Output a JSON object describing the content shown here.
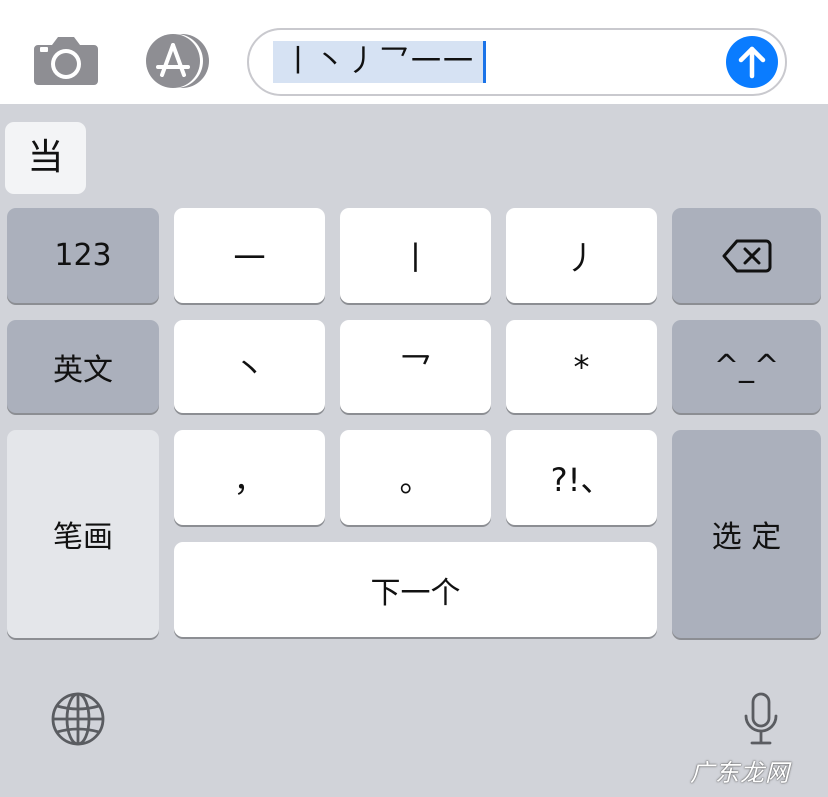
{
  "input": {
    "composing_text": "丨丶丿乛一一"
  },
  "candidates": [
    "当"
  ],
  "keys": {
    "numbers": "123",
    "english": "英文",
    "stroke_heng": "一",
    "stroke_shu": "丨",
    "stroke_pie": "丿",
    "stroke_dian": "丶",
    "stroke_zhe": "乛",
    "wildcard": "*",
    "comma": "，",
    "period": "。",
    "punct": "?!、",
    "next": "下一个",
    "stroke_mode": "笔画",
    "select": "选 定",
    "emoticon": "^_^"
  },
  "watermark": "广东龙网",
  "colors": {
    "send_button": "#0a7cff",
    "function_key": "#abb0bc",
    "keyboard_bg": "#d1d3d9"
  }
}
